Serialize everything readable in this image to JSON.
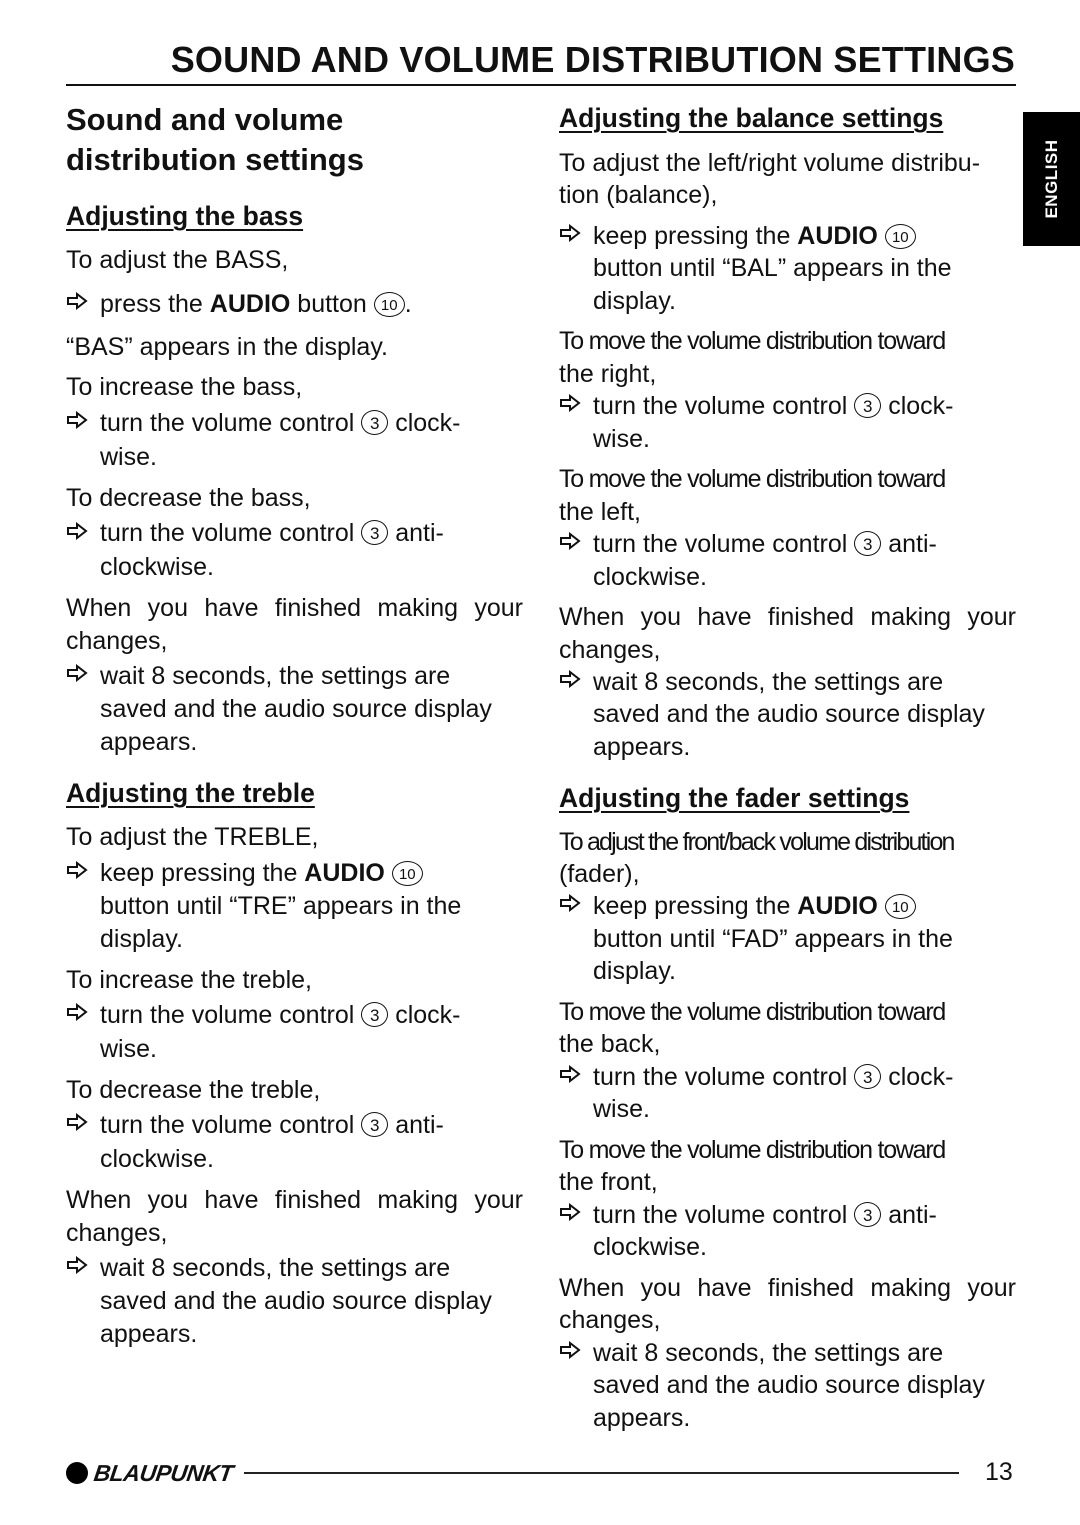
{
  "page_title": "SOUND AND VOLUME DISTRIBUTION SETTINGS",
  "language_tab": "ENGLISH",
  "section_title": [
    "Sound and volume",
    "distribution settings"
  ],
  "bass": {
    "heading": "Adjusting the bass",
    "intro": "To adjust the BASS,",
    "step1_pre": "press the ",
    "step1_bold": "AUDIO",
    "step1_post": " button ",
    "step1_ref": "10",
    "step1_end": ".",
    "display_note": "“BAS” appears in the display.",
    "increase_intro": "To increase the bass,",
    "increase_l1": "turn the volume control ",
    "increase_ref": "3",
    "increase_l1_end": " clock-",
    "increase_l2": "wise.",
    "decrease_intro": "To decrease the bass,",
    "decrease_l1": "turn the volume control ",
    "decrease_ref": "3",
    "decrease_l1_end": " anti-",
    "decrease_l2": "clockwise.",
    "finish_l1": "When you have finished making your",
    "finish_l2": "changes,",
    "wait_l1": "wait 8 seconds, the settings are",
    "wait_l2": "saved and the audio source display",
    "wait_l3": "appears."
  },
  "treble": {
    "heading": "Adjusting the treble",
    "intro": "To adjust the TREBLE,",
    "step1_pre": "keep pressing the ",
    "step1_bold": "AUDIO",
    "step1_ref": "10",
    "step1_l2": "button until “TRE” appears in the",
    "step1_l3": "display.",
    "increase_intro": "To increase the treble,",
    "increase_l1": "turn the volume control ",
    "increase_ref": "3",
    "increase_l1_end": " clock-",
    "increase_l2": "wise.",
    "decrease_intro": "To decrease the treble,",
    "decrease_l1": "turn the volume control ",
    "decrease_ref": "3",
    "decrease_l1_end": " anti-",
    "decrease_l2": "clockwise.",
    "finish_l1": "When you have finished making your",
    "finish_l2": "changes,",
    "wait_l1": "wait 8 seconds, the settings are",
    "wait_l2": "saved and the audio source display",
    "wait_l3": "appears."
  },
  "balance": {
    "heading": "Adjusting the balance settings",
    "intro_l1": "To adjust the left/right volume distribu-",
    "intro_l2": "tion (balance),",
    "step1_pre": "keep pressing the ",
    "step1_bold": "AUDIO",
    "step1_ref": "10",
    "step1_l2": "button until “BAL” appears in the",
    "step1_l3": "display.",
    "right_l1": "To move the volume distribution toward",
    "right_l2": "the right,",
    "right_step_l1": "turn the volume control ",
    "right_ref": "3",
    "right_step_end": " clock-",
    "right_step_l2": "wise.",
    "left_l1": "To move the volume distribution toward",
    "left_l2": "the left,",
    "left_step_l1": "turn the volume control ",
    "left_ref": "3",
    "left_step_end": " anti-",
    "left_step_l2": "clockwise.",
    "finish_l1": "When you have finished making your",
    "finish_l2": "changes,",
    "wait_l1": "wait 8 seconds, the settings are",
    "wait_l2": "saved and the audio source display",
    "wait_l3": "appears."
  },
  "fader": {
    "heading": "Adjusting the fader settings",
    "intro_l1": "To adjust the front/back volume distribution",
    "intro_l2": "(fader),",
    "step1_pre": "keep pressing the ",
    "step1_bold": "AUDIO",
    "step1_ref": "10",
    "step1_l2": "button until “FAD” appears in the",
    "step1_l3": "display.",
    "back_l1": "To move the volume distribution toward",
    "back_l2": "the back,",
    "back_step_l1": "turn the volume control ",
    "back_ref": "3",
    "back_step_end": " clock-",
    "back_step_l2": "wise.",
    "front_l1": "To move the volume distribution toward",
    "front_l2": "the front,",
    "front_step_l1": "turn the volume control ",
    "front_ref": "3",
    "front_step_end": " anti-",
    "front_step_l2": "clockwise.",
    "finish_l1": "When you have finished making your",
    "finish_l2": "changes,",
    "wait_l1": "wait 8 seconds, the settings are",
    "wait_l2": "saved and the audio source display",
    "wait_l3": "appears."
  },
  "footer": {
    "brand": "BLAUPUNKT",
    "page_number": "13"
  }
}
